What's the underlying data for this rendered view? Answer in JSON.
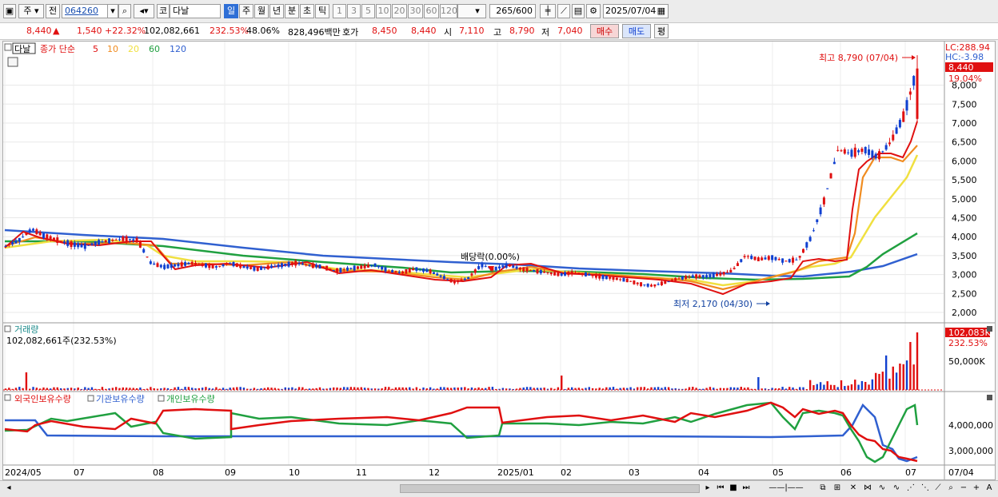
{
  "toolbar": {
    "type_label": "주",
    "prefix_label": "전",
    "code": "064260",
    "market_label": "코",
    "name": "다날",
    "periods": [
      "일",
      "주",
      "월",
      "년",
      "분",
      "초",
      "틱"
    ],
    "active_period": "일",
    "intervals": [
      "1",
      "3",
      "5",
      "10",
      "20",
      "30",
      "60",
      "120"
    ],
    "count_value": "265",
    "count_max": "/600",
    "date": "2025/07/04"
  },
  "quote": {
    "price": "8,440",
    "change": "1,540",
    "change_pct": "+22.32%",
    "volume": "102,082,661",
    "volume_ratio": "232.53%",
    "turnover": "48.06%",
    "amount": "828,496백만",
    "hoga_label": "호가",
    "ask": "8,450",
    "bid": "8,440",
    "open_label": "시",
    "open": "7,110",
    "high_label": "고",
    "high": "8,790",
    "low_label": "저",
    "low": "7,040",
    "buy_label": "매수",
    "sell_label": "매도",
    "avg_label": "평"
  },
  "price_panel": {
    "stock_tag": "다날",
    "ma_title": "종가 단순",
    "ma_periods": [
      "5",
      "10",
      "20",
      "60",
      "120"
    ],
    "ma_colors": [
      "#e01010",
      "#f08c20",
      "#f0e040",
      "#20a040",
      "#3060d0"
    ],
    "lc_label": "LC:288.94",
    "hc_label": "HC:-3.98",
    "current_price": "8,440",
    "current_pct": "19.04%",
    "y_ticks": [
      "8,000",
      "7,500",
      "7,000",
      "6,500",
      "6,000",
      "5,500",
      "5,000",
      "4,500",
      "4,000",
      "3,500",
      "3,000",
      "2,500",
      "2,000"
    ],
    "high_annotation": "최고 8,790 (07/04)",
    "low_annotation": "최저 2,170 (04/30)",
    "dividend_annotation": "배당락(0.00%)"
  },
  "volume_panel": {
    "title": "거래량",
    "value_text": "102,082,661주(232.53%)",
    "current": "102,083K",
    "current_pct": "232.53%",
    "y_ticks": [
      "50,000K"
    ]
  },
  "holding_panel": {
    "series": [
      {
        "name": "외국인보유수량",
        "color": "#e01010"
      },
      {
        "name": "기관보유수량",
        "color": "#3060d0"
      },
      {
        "name": "개인보유수량",
        "color": "#20a040"
      }
    ],
    "y_ticks": [
      "4,000,000",
      "3,000,000"
    ]
  },
  "x_axis": {
    "labels": [
      "2024/05",
      "07",
      "08",
      "09",
      "10",
      "11",
      "12",
      "2025/01",
      "02",
      "03",
      "04",
      "05",
      "06",
      "07"
    ],
    "right_label": "07/04"
  },
  "chart_data": {
    "type": "line",
    "title": "",
    "y_ticks": [
      8000,
      7500,
      7000,
      6500,
      6000,
      5500,
      5000,
      4500,
      4000,
      3500,
      3000,
      2500,
      2000
    ],
    "series": [
      {
        "name": "종가",
        "values": [
          3750,
          3900,
          4200,
          4000,
          3900,
          3800,
          3750,
          3850,
          3900,
          3950,
          3900,
          3300,
          3200,
          3250,
          3300,
          3250,
          3200,
          3300,
          3200,
          3150,
          3200,
          3250,
          3300,
          3250,
          3200,
          3100,
          3150,
          3200,
          3250,
          3100,
          3050,
          3150,
          3100,
          2950,
          2800,
          2900,
          3250,
          3150,
          3250,
          3150,
          3100,
          3050,
          3000,
          3050,
          3000,
          2950,
          2900,
          2850,
          2750,
          2700,
          2800,
          2900,
          2950,
          2950,
          3000,
          3100,
          3500,
          3400,
          3450,
          3350,
          3400,
          4000,
          5000,
          6300,
          6200,
          6300,
          6100,
          6500,
          7200,
          8440
        ]
      }
    ],
    "extremes": {
      "high": 8790,
      "high_date": "07/04",
      "low": 2170,
      "low_date": "04/30"
    },
    "x_labels": [
      "2024/05",
      "07",
      "08",
      "09",
      "10",
      "11",
      "12",
      "2025/01",
      "02",
      "03",
      "04",
      "05",
      "06",
      "07"
    ]
  }
}
